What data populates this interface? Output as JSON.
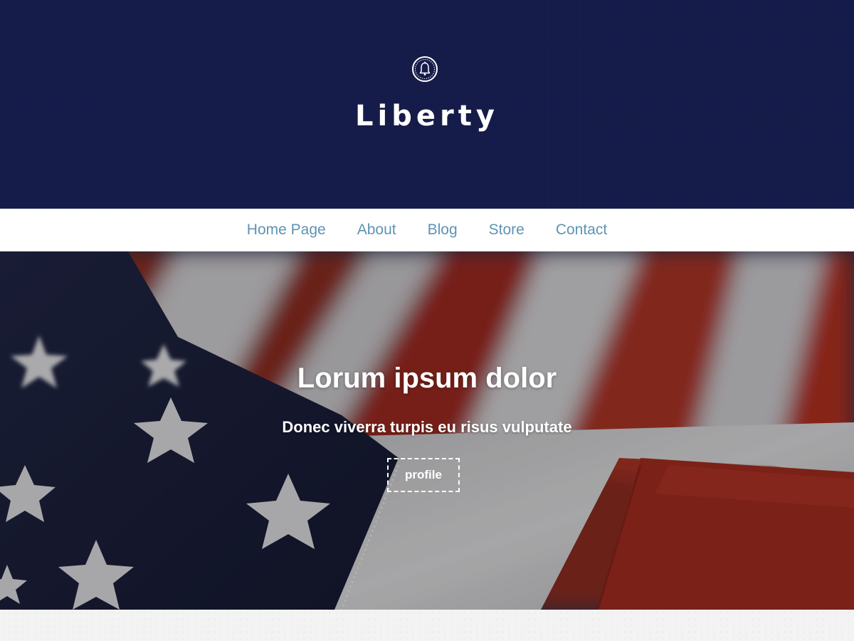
{
  "header": {
    "site_title": "Liberty",
    "logo_icon": "liberty-bell-icon",
    "background_color": "#151b4a"
  },
  "nav": {
    "items": [
      {
        "label": "Home Page"
      },
      {
        "label": "About"
      },
      {
        "label": "Blog"
      },
      {
        "label": "Store"
      },
      {
        "label": "Contact"
      }
    ],
    "link_color": "#5e93b3"
  },
  "hero": {
    "title": "Lorum ipsum dolor",
    "subtitle": "Donec viverra turpis eu risus vulputate",
    "button_label": "profile",
    "background_image": "american-flag-photo"
  }
}
